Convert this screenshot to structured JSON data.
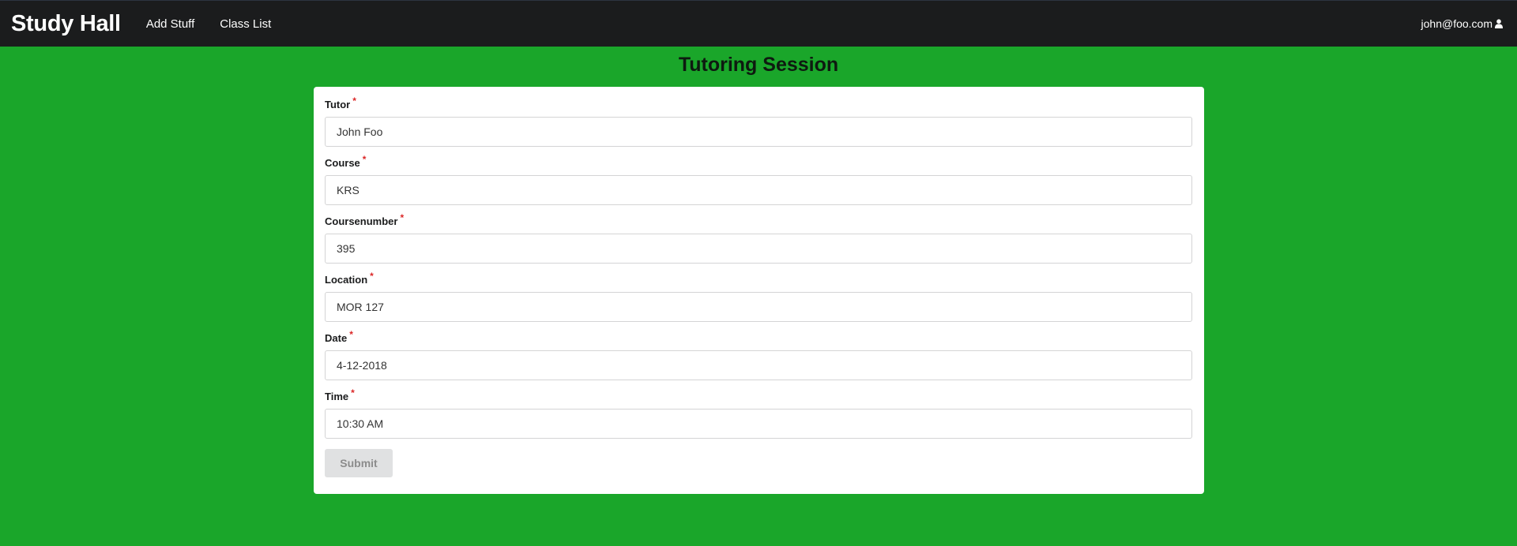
{
  "navbar": {
    "brand": "Study Hall",
    "items": [
      {
        "label": "Add Stuff"
      },
      {
        "label": "Class List"
      }
    ],
    "user_email": "john@foo.com",
    "user_icon": "user-icon"
  },
  "page": {
    "title": "Tutoring Session"
  },
  "form": {
    "required_marker": "*",
    "fields": [
      {
        "label": "Tutor",
        "value": "John Foo"
      },
      {
        "label": "Course",
        "value": "KRS"
      },
      {
        "label": "Coursenumber",
        "value": "395"
      },
      {
        "label": "Location",
        "value": "MOR 127"
      },
      {
        "label": "Date",
        "value": "4-12-2018"
      },
      {
        "label": "Time",
        "value": "10:30 AM"
      }
    ],
    "submit_label": "Submit"
  },
  "colors": {
    "background": "#1aa62a",
    "navbar": "#1b1c1d",
    "required": "#db2828"
  }
}
